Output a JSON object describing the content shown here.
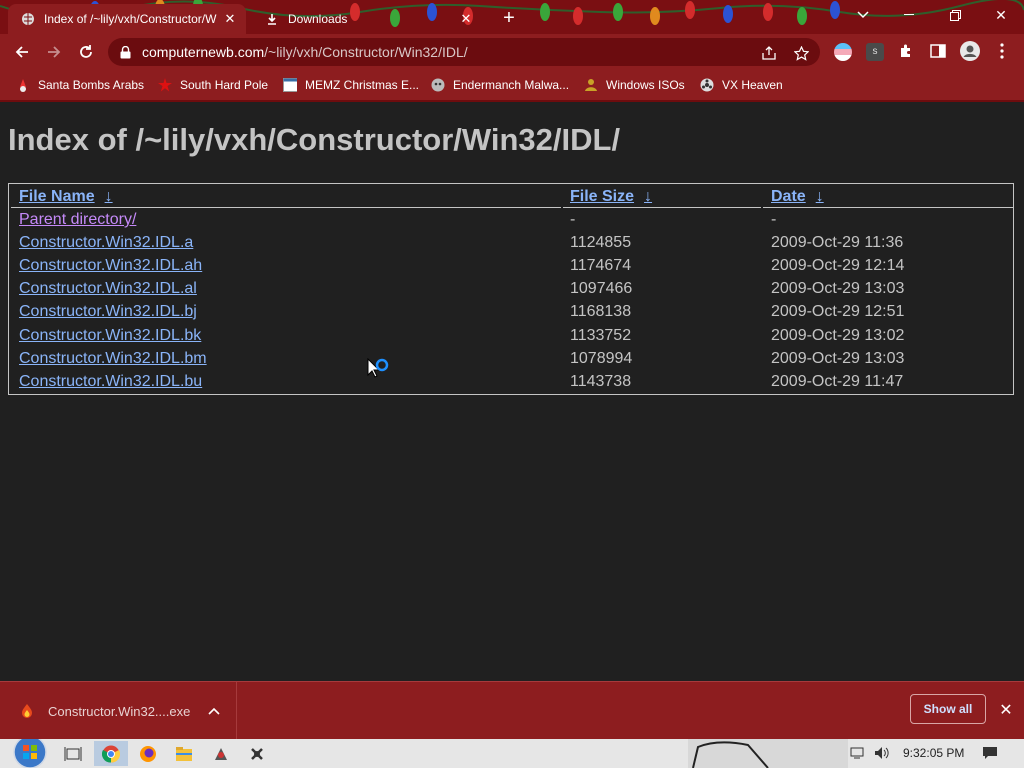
{
  "browser": {
    "tabs": [
      {
        "title": "Index of /~lily/vxh/Constructor/W",
        "active": true
      },
      {
        "title": "Downloads",
        "active": false
      }
    ],
    "url_host": "computernewb.com",
    "url_path": "/~lily/vxh/Constructor/Win32/IDL/",
    "bookmarks": [
      {
        "label": "Santa Bombs Arabs"
      },
      {
        "label": "South Hard Pole"
      },
      {
        "label": "MEMZ Christmas E..."
      },
      {
        "label": "Endermanch Malwa..."
      },
      {
        "label": "Windows ISOs"
      },
      {
        "label": "VX Heaven"
      }
    ],
    "colors": {
      "chrome": "#8d1d1f",
      "tabstrip": "#7a0f12",
      "link": "#8ab4f8",
      "visited": "#c58af9",
      "text": "#c4c4c4"
    }
  },
  "page": {
    "title": "Index of /~lily/vxh/Constructor/Win32/IDL/",
    "columns": {
      "name": "File Name",
      "size": "File Size",
      "date": "Date",
      "sort_arrow": "↓"
    },
    "parent": {
      "name": "Parent directory/",
      "size": "-",
      "date": "-"
    },
    "rows": [
      {
        "name": "Constructor.Win32.IDL.a",
        "size": "1124855",
        "date": "2009-Oct-29 11:36"
      },
      {
        "name": "Constructor.Win32.IDL.ah",
        "size": "1174674",
        "date": "2009-Oct-29 12:14"
      },
      {
        "name": "Constructor.Win32.IDL.al",
        "size": "1097466",
        "date": "2009-Oct-29 13:03"
      },
      {
        "name": "Constructor.Win32.IDL.bj",
        "size": "1168138",
        "date": "2009-Oct-29 12:51"
      },
      {
        "name": "Constructor.Win32.IDL.bk",
        "size": "1133752",
        "date": "2009-Oct-29 13:02"
      },
      {
        "name": "Constructor.Win32.IDL.bm",
        "size": "1078994",
        "date": "2009-Oct-29 13:03"
      },
      {
        "name": "Constructor.Win32.IDL.bu",
        "size": "1143738",
        "date": "2009-Oct-29 11:47"
      }
    ]
  },
  "downloads": {
    "file": "Constructor.Win32....exe",
    "show_all": "Show all"
  },
  "taskbar": {
    "clock": "9:32:05 PM"
  }
}
